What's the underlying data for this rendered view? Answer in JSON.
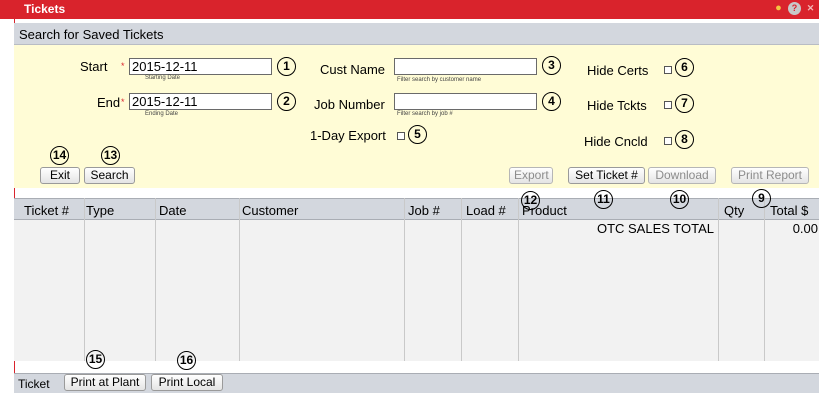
{
  "window": {
    "title": "Tickets"
  },
  "search": {
    "header": "Search for Saved Tickets",
    "start": {
      "label": "Start",
      "value": "2015-12-11",
      "hint": "Starting Date"
    },
    "end": {
      "label": "End",
      "value": "2015-12-11",
      "hint": "Ending Date"
    },
    "cust_name": {
      "label": "Cust Name",
      "value": "",
      "hint": "Filter search by customer name"
    },
    "job_number": {
      "label": "Job Number",
      "value": "",
      "hint": "Filter search by job #"
    },
    "one_day_export": {
      "label": "1-Day Export",
      "checked": false
    },
    "hide_certs": {
      "label": "Hide Certs",
      "checked": false
    },
    "hide_tckts": {
      "label": "Hide Tckts",
      "checked": false
    },
    "hide_cncld": {
      "label": "Hide Cncld",
      "checked": false
    },
    "buttons": {
      "exit": "Exit",
      "search": "Search",
      "export": "Export",
      "set_ticket": "Set Ticket #",
      "download": "Download",
      "print_report": "Print Report"
    }
  },
  "grid": {
    "columns": [
      "Ticket #",
      "Type",
      "Date",
      "Customer",
      "Job #",
      "Load #",
      "Product",
      "Qty",
      "Total $"
    ],
    "totals_label": "OTC SALES TOTAL",
    "totals_value": "0.00"
  },
  "footer": {
    "label": "Ticket",
    "print_at_plant": "Print at Plant",
    "print_local": "Print Local"
  },
  "callouts": {
    "c1": "1",
    "c2": "2",
    "c3": "3",
    "c4": "4",
    "c5": "5",
    "c6": "6",
    "c7": "7",
    "c8": "8",
    "c9": "9",
    "c10": "10",
    "c11": "11",
    "c12": "12",
    "c13": "13",
    "c14": "14",
    "c15": "15",
    "c16": "16"
  },
  "colors": {
    "titlebar": "#d9232c",
    "panel": "#fffcd6",
    "header": "#d3d7de"
  },
  "icons": [
    "lightbulb-icon",
    "help-icon",
    "close-icon"
  ]
}
